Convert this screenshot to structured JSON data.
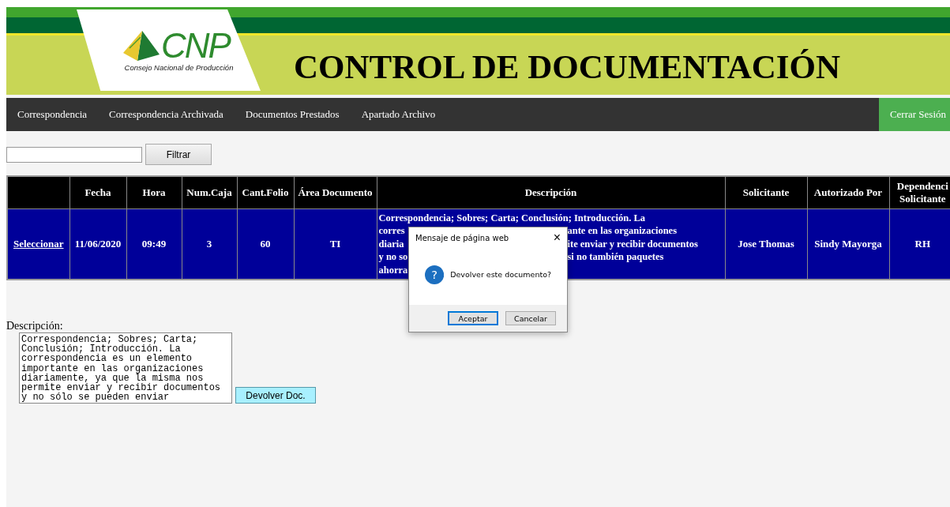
{
  "header": {
    "logo_mark": "CNP",
    "logo_subtitle": "Consejo Nacional de Producción",
    "title": "CONTROL DE DOCUMENTACIÓN"
  },
  "nav": {
    "items": [
      {
        "label": "Correspondencia"
      },
      {
        "label": "Correspondencia Archivada"
      },
      {
        "label": "Documentos Prestados"
      },
      {
        "label": "Apartado Archivo"
      }
    ],
    "logout": "Cerrar Sesión"
  },
  "filter": {
    "button": "Filtrar"
  },
  "table": {
    "columns": [
      "",
      "Fecha",
      "Hora",
      "Num.Caja",
      "Cant.Folio",
      "Área Documento",
      "Descripción",
      "Solicitante",
      "Autorizado Por",
      "Dependenci Solicitante"
    ],
    "rows": [
      {
        "selected": true,
        "cells": [
          "Seleccionar",
          "11/06/2020",
          "09:49",
          "3",
          "60",
          "TI",
          {
            "lines": [
              [
                "Correspondencia; Sobres; Carta; Conclusión; Introducción. La"
              ],
              [
                "corres",
                "ante en las organizaciones"
              ],
              [
                "diaria",
                "ite enviar y recibir documentos"
              ],
              [
                "y no so",
                "si no también paquetes"
              ],
              [
                "ahorra"
              ]
            ]
          },
          "Jose Thomas",
          "Sindy Mayorga",
          "RH"
        ]
      }
    ]
  },
  "description": {
    "label": "Descripción:",
    "value": "Correspondencia; Sobres; Carta; Conclusión; Introducción. La correspondencia es un elemento importante en las organizaciones diariamente, ya que la misma nos permite enviar y recibir documentos y no sólo se pueden enviar",
    "button": "Devolver Doc."
  },
  "dialog": {
    "title": "Mensaje de página web",
    "close": "×",
    "icon": "?",
    "message": "Devolver este documento?",
    "buttons": [
      {
        "label": "Aceptar",
        "focused": true
      },
      {
        "label": "Cancelar",
        "focused": false
      }
    ]
  }
}
